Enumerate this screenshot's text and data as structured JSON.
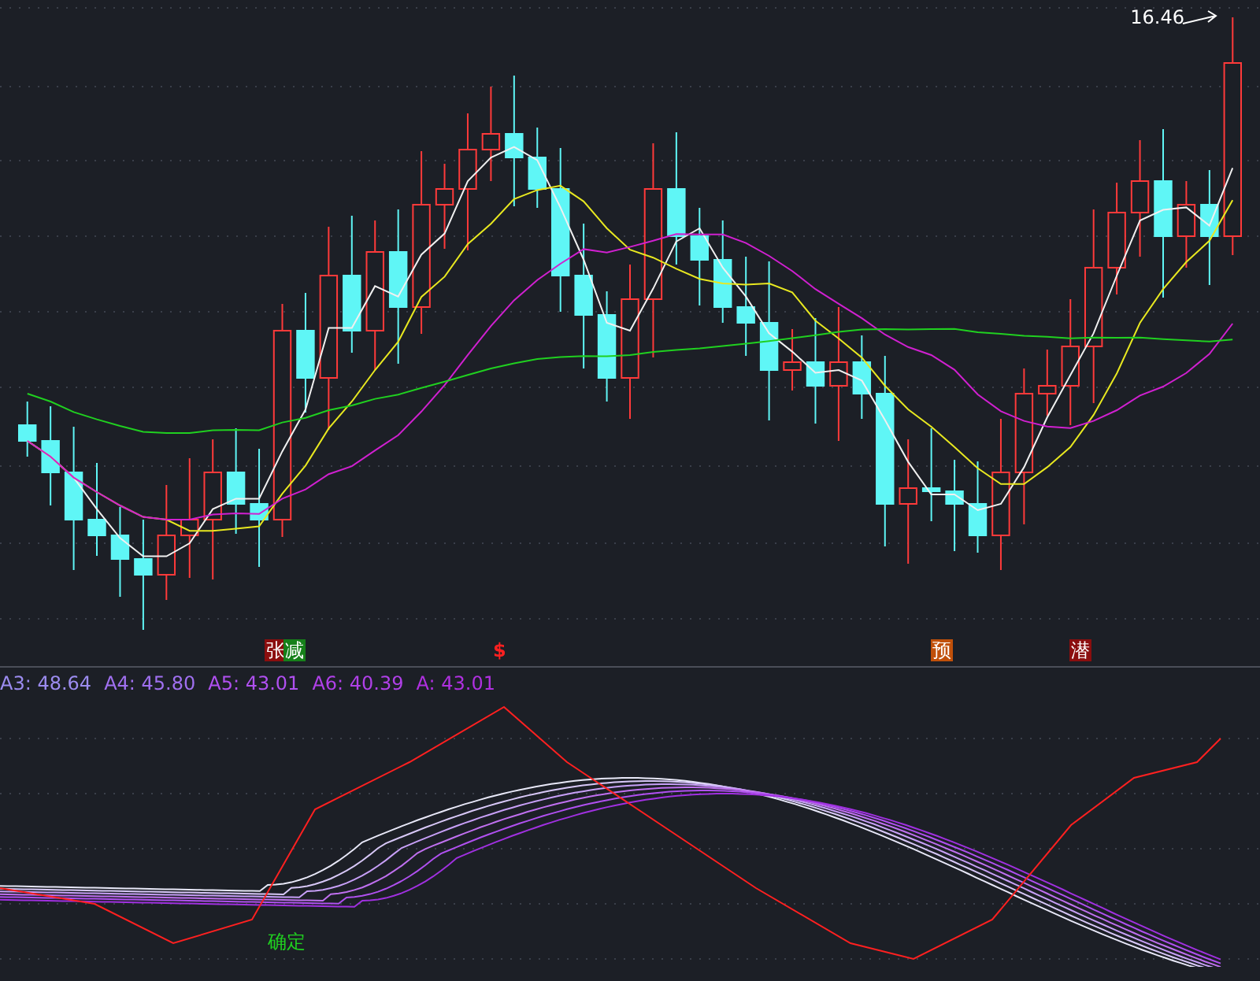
{
  "price_label": "16.46",
  "signals": [
    {
      "text": "张",
      "kind": "boxed",
      "color": "#8b0e0e"
    },
    {
      "text": "减",
      "kind": "boxed",
      "color": "#16801a"
    },
    {
      "text": "$",
      "kind": "plain",
      "color": "#ff2020"
    },
    {
      "text": "预",
      "kind": "boxed",
      "color": "#c0500a"
    },
    {
      "text": "潜",
      "kind": "boxed",
      "color": "#8b0e0e"
    }
  ],
  "legend": [
    {
      "label": "A3: 48.64",
      "color": "#9c8cf0"
    },
    {
      "label": "A4: 45.80",
      "color": "#a070f0"
    },
    {
      "label": "A5: 43.01",
      "color": "#b050f0"
    },
    {
      "label": "A6: 40.39",
      "color": "#b040e8"
    },
    {
      "label": "A: 43.01",
      "color": "#b030e0"
    }
  ],
  "confirm_label": "确定"
}
